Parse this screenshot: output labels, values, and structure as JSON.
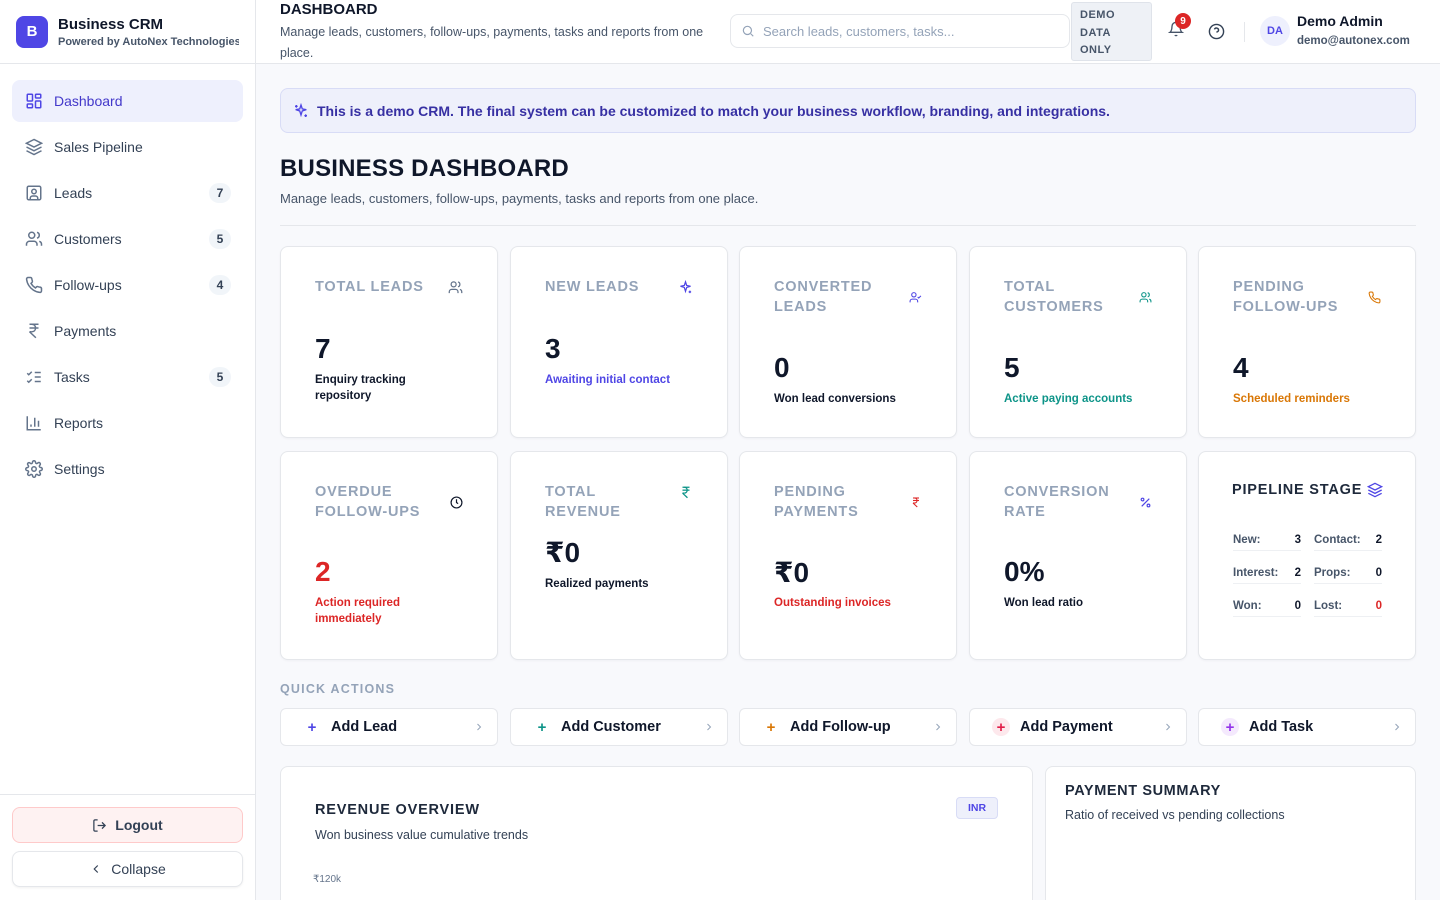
{
  "brand": {
    "logo_letter": "B",
    "title": "Business CRM",
    "subtitle": "Powered by AutoNex Technologies"
  },
  "sidebar": {
    "items": [
      {
        "label": "Dashboard",
        "icon": "dashboard-icon",
        "badge": ""
      },
      {
        "label": "Sales Pipeline",
        "icon": "layers-icon",
        "badge": ""
      },
      {
        "label": "Leads",
        "icon": "contact-card-icon",
        "badge": "7"
      },
      {
        "label": "Customers",
        "icon": "users-icon",
        "badge": "5"
      },
      {
        "label": "Follow-ups",
        "icon": "phone-icon",
        "badge": "4"
      },
      {
        "label": "Payments",
        "icon": "rupee-icon",
        "badge": ""
      },
      {
        "label": "Tasks",
        "icon": "checklist-icon",
        "badge": "5"
      },
      {
        "label": "Reports",
        "icon": "bar-chart-icon",
        "badge": ""
      },
      {
        "label": "Settings",
        "icon": "gear-icon",
        "badge": ""
      }
    ],
    "logout_label": "Logout",
    "collapse_label": "Collapse"
  },
  "header": {
    "title": "DASHBOARD",
    "subtitle": "Manage leads, customers, follow-ups, payments, tasks and reports from one place.",
    "search_placeholder": "Search leads, customers, tasks...",
    "demo_tag": "DEMO DATA ONLY",
    "notification_count": "9",
    "user": {
      "initials": "DA",
      "name": "Demo Admin",
      "email": "demo@autonex.com"
    }
  },
  "banner": {
    "text": "This is a demo CRM. The final system can be customized to match your business workflow, branding, and integrations."
  },
  "page": {
    "title": "BUSINESS DASHBOARD",
    "subtitle": "Manage leads, customers, follow-ups, payments, tasks and reports from one place."
  },
  "stats": [
    {
      "label": "Total Leads",
      "value": "7",
      "note": "Enquiry tracking repository",
      "icon": "users-icon",
      "note_color": "#0f172a",
      "value_color": "#0f172a"
    },
    {
      "label": "New Leads",
      "value": "3",
      "note": "Awaiting initial contact",
      "icon": "sparkles-icon",
      "note_color": "#4f46e5",
      "value_color": "#0f172a"
    },
    {
      "label": "Converted Leads",
      "value": "0",
      "note": "Won lead conversions",
      "icon": "user-check-icon",
      "note_color": "#0f172a",
      "value_color": "#0f172a"
    },
    {
      "label": "Total Customers",
      "value": "5",
      "note": "Active paying accounts",
      "icon": "users-icon",
      "note_color": "#0d9488",
      "value_color": "#0f172a"
    },
    {
      "label": "Pending Follow-ups",
      "value": "4",
      "note": "Scheduled reminders",
      "icon": "phone-icon",
      "note_color": "#d97706",
      "value_color": "#0f172a"
    },
    {
      "label": "Overdue Follow-ups",
      "value": "2",
      "note": "Action required immediately",
      "icon": "clock-icon",
      "note_color": "#dc2626",
      "value_color": "#dc2626"
    },
    {
      "label": "Total Revenue",
      "value": "₹0",
      "note": "Realized payments",
      "icon": "rupee-icon",
      "note_color": "#0f172a",
      "value_color": "#0f172a"
    },
    {
      "label": "Pending Payments",
      "value": "₹0",
      "note": "Outstanding invoices",
      "icon": "rupee-icon",
      "note_color": "#dc2626",
      "value_color": "#0f172a"
    },
    {
      "label": "Conversion Rate",
      "value": "0%",
      "note": "Won lead ratio",
      "icon": "percent-icon",
      "note_color": "#0f172a",
      "value_color": "#0f172a"
    }
  ],
  "pipeline": {
    "title": "PIPELINE STAGE",
    "stages": [
      {
        "key": "New:",
        "value": "3",
        "color": "#0f172a"
      },
      {
        "key": "Contact:",
        "value": "2",
        "color": "#0f172a"
      },
      {
        "key": "Interest:",
        "value": "2",
        "color": "#0f172a"
      },
      {
        "key": "Props:",
        "value": "0",
        "color": "#0f172a"
      },
      {
        "key": "Won:",
        "value": "0",
        "color": "#0f172a"
      },
      {
        "key": "Lost:",
        "value": "0",
        "color": "#dc2626"
      }
    ]
  },
  "quick_actions": {
    "title": "QUICK ACTIONS",
    "items": [
      {
        "label": "Add Lead",
        "color": "#4f46e5",
        "bg": "#eef0fd"
      },
      {
        "label": "Add Customer",
        "color": "#0d9488",
        "bg": "#e6f6f4"
      },
      {
        "label": "Add Follow-up",
        "color": "#d97706",
        "bg": "#fdf4e4"
      },
      {
        "label": "Add Payment",
        "color": "#e11d48",
        "bg": "#fde8ec"
      },
      {
        "label": "Add Task",
        "color": "#9333ea",
        "bg": "#f4e9fd"
      }
    ]
  },
  "revenue": {
    "title": "REVENUE OVERVIEW",
    "subtitle": "Won business value cumulative trends",
    "currency_badge": "INR",
    "top_tick": "₹120k"
  },
  "payment_summary": {
    "title": "PAYMENT SUMMARY",
    "subtitle": "Ratio of received vs pending collections"
  },
  "colors": {
    "accent": "#4f46e5",
    "danger": "#dc2626",
    "teal": "#0d9488",
    "amber": "#d97706"
  }
}
